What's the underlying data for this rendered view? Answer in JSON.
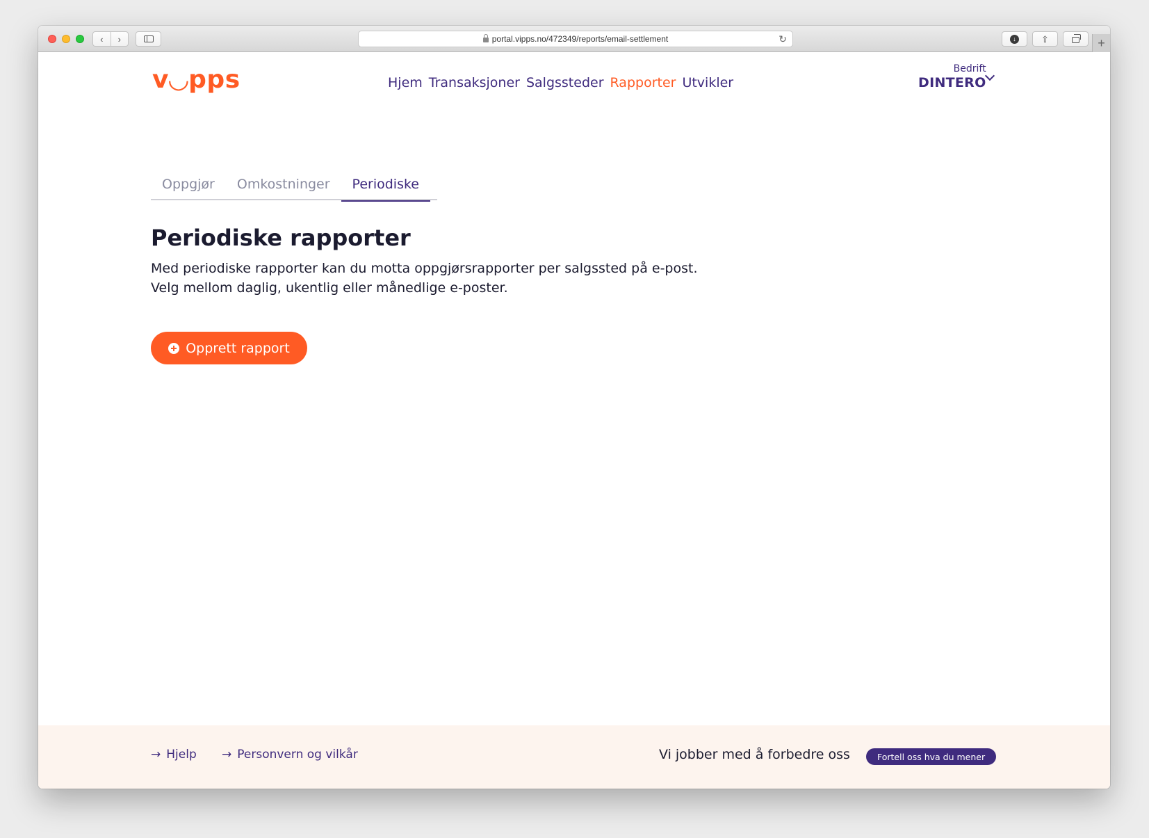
{
  "browser": {
    "url": "portal.vipps.no/472349/reports/email-settlement",
    "back_glyph": "‹",
    "forward_glyph": "›",
    "reload_glyph": "↻",
    "download_glyph": "↓",
    "share_glyph": "⇧",
    "newtab_glyph": "+"
  },
  "header": {
    "logo": "v◡pps",
    "nav": [
      {
        "label": "Hjem",
        "active": false
      },
      {
        "label": "Transaksjoner",
        "active": false
      },
      {
        "label": "Salgssteder",
        "active": false
      },
      {
        "label": "Rapporter",
        "active": true
      },
      {
        "label": "Utvikler",
        "active": false
      }
    ],
    "company_label": "Bedrift",
    "company_name": "DINTERO"
  },
  "tabs": [
    {
      "label": "Oppgjør",
      "active": false
    },
    {
      "label": "Omkostninger",
      "active": false
    },
    {
      "label": "Periodiske",
      "active": true
    }
  ],
  "main": {
    "title": "Periodiske rapporter",
    "description_line1": "Med periodiske rapporter kan du motta oppgjørsrapporter per salgssted på e-post.",
    "description_line2": "Velg mellom daglig, ukentlig eller månedlige e-poster.",
    "create_button": "Opprett rapport"
  },
  "footer": {
    "help_link": "Hjelp",
    "privacy_link": "Personvern og vilkår",
    "feedback_text": "Vi jobber med å forbedre oss",
    "feedback_button": "Fortell oss hva du mener",
    "arrow_glyph": "→"
  },
  "colors": {
    "brand_orange": "#ff5b24",
    "brand_purple": "#3f2b7e",
    "footer_background": "#fdf4ee"
  }
}
